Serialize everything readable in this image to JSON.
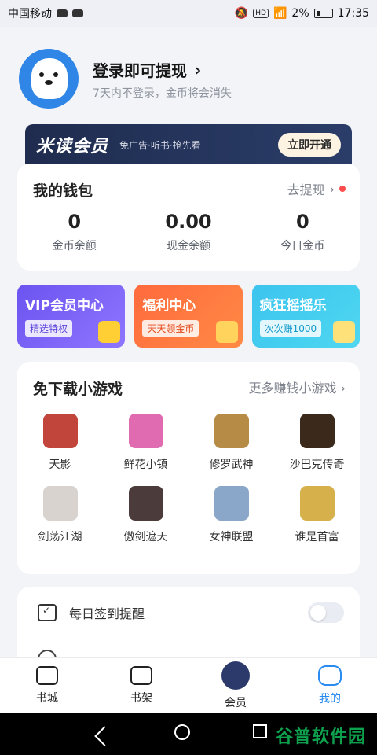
{
  "status": {
    "carrier": "中国移动",
    "battery": "2%",
    "time": "17:35",
    "hd": "HD"
  },
  "profile": {
    "title": "登录即可提现",
    "subtitle": "7天内不登录，金币将会消失"
  },
  "vip_banner": {
    "brand": "米读会员",
    "desc": "免广告·听书·抢先看",
    "button": "立即开通"
  },
  "wallet": {
    "title": "我的钱包",
    "withdraw": "去提现",
    "stats": [
      {
        "value": "0",
        "label": "金币余额"
      },
      {
        "value": "0.00",
        "label": "现金余额"
      },
      {
        "value": "0",
        "label": "今日金币"
      }
    ]
  },
  "features": [
    {
      "name": "VIP会员中心",
      "tag": "精选特权"
    },
    {
      "name": "福利中心",
      "tag": "天天领金币"
    },
    {
      "name": "疯狂摇摇乐",
      "tag": "次次赚1000"
    }
  ],
  "games": {
    "title": "免下载小游戏",
    "more": "更多赚钱小游戏",
    "items": [
      {
        "name": "天影",
        "color": "#c2453c"
      },
      {
        "name": "鲜花小镇",
        "color": "#e06bb1"
      },
      {
        "name": "修罗武神",
        "color": "#b58b45"
      },
      {
        "name": "沙巴克传奇",
        "color": "#3b2a1c"
      },
      {
        "name": "剑荡江湖",
        "color": "#d9d3cf"
      },
      {
        "name": "傲剑遮天",
        "color": "#4b3b3a"
      },
      {
        "name": "女神联盟",
        "color": "#8aa6c8"
      },
      {
        "name": "谁是首富",
        "color": "#d6b04a"
      }
    ]
  },
  "settings": {
    "daily_signin": "每日签到提醒"
  },
  "tabbar": [
    {
      "label": "书城"
    },
    {
      "label": "书架"
    },
    {
      "label": "会员"
    },
    {
      "label": "我的"
    }
  ],
  "watermark": "谷普软件园"
}
